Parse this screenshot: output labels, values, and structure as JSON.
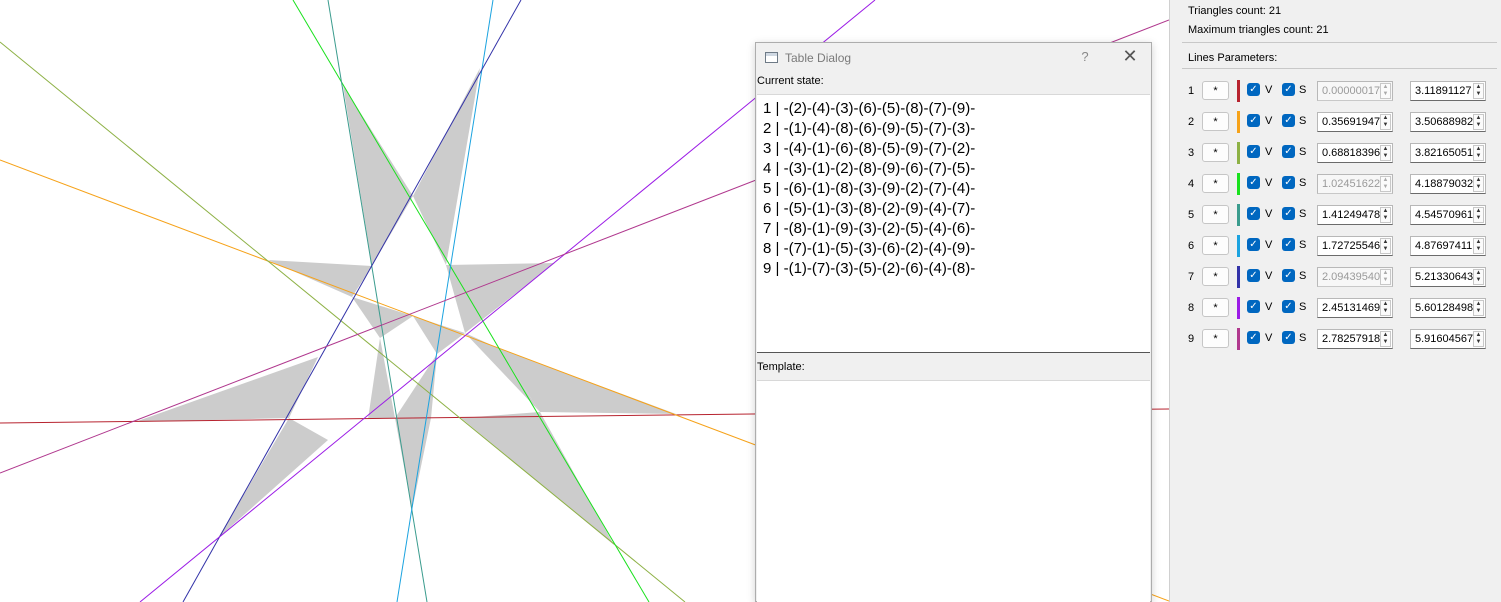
{
  "stats": {
    "triangles_count": "Triangles count: 21",
    "max_triangles_count": "Maximum triangles count: 21",
    "lines_parameters": "Lines Parameters:"
  },
  "lines": [
    {
      "num": "1",
      "star": "*",
      "color": "#b7232f",
      "v": "V",
      "s": "S",
      "angle": "0.00000017",
      "angle_disabled": true,
      "offset": "3.11891127"
    },
    {
      "num": "2",
      "star": "*",
      "color": "#f6a219",
      "v": "V",
      "s": "S",
      "angle": "0.35691947",
      "angle_disabled": false,
      "offset": "3.50688982"
    },
    {
      "num": "3",
      "star": "*",
      "color": "#8db145",
      "v": "V",
      "s": "S",
      "angle": "0.68818396",
      "angle_disabled": false,
      "offset": "3.82165051"
    },
    {
      "num": "4",
      "star": "*",
      "color": "#19e11d",
      "v": "V",
      "s": "S",
      "angle": "1.02451622",
      "angle_disabled": true,
      "offset": "4.18879032"
    },
    {
      "num": "5",
      "star": "*",
      "color": "#3b9c8e",
      "v": "V",
      "s": "S",
      "angle": "1.41249478",
      "angle_disabled": false,
      "offset": "4.54570961"
    },
    {
      "num": "6",
      "star": "*",
      "color": "#1ba3e0",
      "v": "V",
      "s": "S",
      "angle": "1.72725546",
      "angle_disabled": false,
      "offset": "4.87697411"
    },
    {
      "num": "7",
      "star": "*",
      "color": "#3232a8",
      "v": "V",
      "s": "S",
      "angle": "2.09439540",
      "angle_disabled": true,
      "offset": "5.21330643"
    },
    {
      "num": "8",
      "star": "*",
      "color": "#9b1be6",
      "v": "V",
      "s": "S",
      "angle": "2.45131469",
      "angle_disabled": false,
      "offset": "5.60128498"
    },
    {
      "num": "9",
      "star": "*",
      "color": "#b0388e",
      "v": "V",
      "s": "S",
      "angle": "2.78257918",
      "angle_disabled": false,
      "offset": "5.91604567"
    }
  ],
  "dialog": {
    "title": "Table Dialog",
    "help": "?",
    "close": "✕",
    "current_state_label": "Current state:",
    "template_label": "Template:",
    "state_lines": [
      "1 | -(2)-(4)-(3)-(6)-(5)-(8)-(7)-(9)-",
      "2 | -(1)-(4)-(8)-(6)-(9)-(5)-(7)-(3)-",
      "3 | -(4)-(1)-(6)-(8)-(5)-(9)-(7)-(2)-",
      "4 | -(3)-(1)-(2)-(8)-(9)-(6)-(7)-(5)-",
      "5 | -(6)-(1)-(8)-(3)-(9)-(2)-(7)-(4)-",
      "6 | -(5)-(1)-(3)-(8)-(2)-(9)-(4)-(7)-",
      "7 | -(8)-(1)-(9)-(3)-(2)-(5)-(4)-(6)-",
      "8 | -(7)-(1)-(5)-(3)-(6)-(2)-(4)-(9)-",
      "9 | -(1)-(7)-(3)-(5)-(2)-(6)-(4)-(8)-"
    ]
  },
  "colors": {
    "triangle_fill": "#cccccc",
    "checkbox": "#0067c0"
  }
}
